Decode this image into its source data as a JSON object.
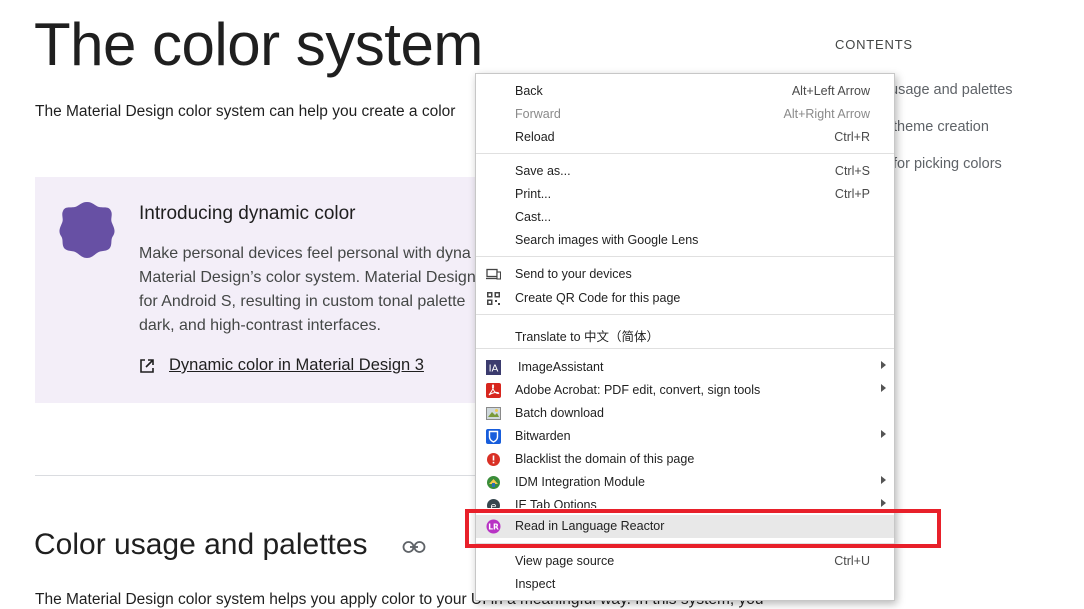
{
  "page": {
    "title": "The color system",
    "intro": "The Material Design color system can help you create a color",
    "callout": {
      "title": "Introducing dynamic color",
      "lines": [
        "Make personal devices feel personal with dyna",
        "Material Design’s color system. Material Design",
        "for Android S, resulting in custom tonal palette",
        "dark, and high-contrast interfaces."
      ],
      "link": "Dynamic color in Material Design 3"
    },
    "section_heading": "Color usage and palettes",
    "section_body": "The Material Design color system helps you apply color to your UI in a meaningful way. In this system, you"
  },
  "toc": {
    "label": "CONTENTS",
    "items": [
      "usage and palettes",
      "theme creation",
      "for picking colors"
    ]
  },
  "menu": {
    "items": [
      {
        "label": "Back",
        "shortcut": "Alt+Left Arrow"
      },
      {
        "label": "Forward",
        "shortcut": "Alt+Right Arrow",
        "disabled": true
      },
      {
        "label": "Reload",
        "shortcut": "Ctrl+R"
      },
      {
        "label": "Save as...",
        "shortcut": "Ctrl+S"
      },
      {
        "label": "Print...",
        "shortcut": "Ctrl+P"
      },
      {
        "label": "Cast...",
        "shortcut": ""
      },
      {
        "label": "Search images with Google Lens",
        "shortcut": ""
      },
      {
        "label": "Send to your devices",
        "icon": "devices-icon"
      },
      {
        "label": "Create QR Code for this page",
        "icon": "qr-code-icon"
      },
      {
        "label": "Translate to 中文（简体）",
        "shortcut": ""
      },
      {
        "label": "ImageAssistant",
        "icon": "imageassistant-icon",
        "submenu": true
      },
      {
        "label": "Adobe Acrobat: PDF edit, convert, sign tools",
        "icon": "acrobat-icon",
        "submenu": true
      },
      {
        "label": "Batch download",
        "icon": "batch-download-icon"
      },
      {
        "label": "Bitwarden",
        "icon": "bitwarden-icon",
        "submenu": true
      },
      {
        "label": "Blacklist the domain of this page",
        "icon": "blacklist-icon"
      },
      {
        "label": "IDM Integration Module",
        "icon": "idm-icon",
        "submenu": true
      },
      {
        "label": "IE Tab Options",
        "icon": "ie-tab-icon",
        "submenu": true
      },
      {
        "label": "Read in Language Reactor",
        "icon": "language-reactor-icon",
        "highlighted": true
      },
      {
        "label": "View page source",
        "shortcut": "Ctrl+U"
      },
      {
        "label": "Inspect",
        "shortcut": ""
      }
    ]
  },
  "colors": {
    "callout_bg": "#f3eef8",
    "blob": "#6750a4",
    "highlight_box": "#e8202a",
    "menu_highlight": "#e8e8e8"
  }
}
